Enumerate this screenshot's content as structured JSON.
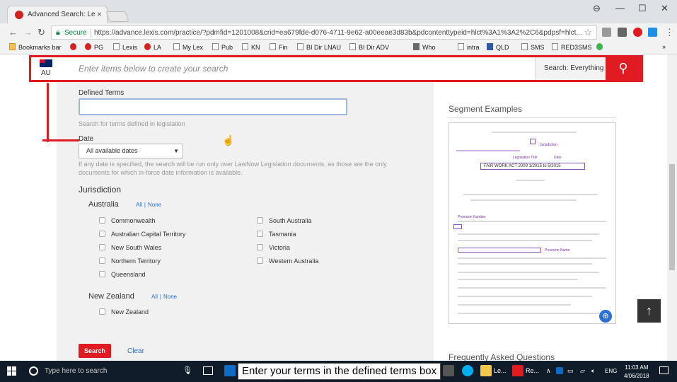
{
  "browser": {
    "tab_title": "Advanced Search: Legisla",
    "tab_close": "×",
    "window_controls": [
      "⊖",
      "—",
      "☐",
      "✕"
    ],
    "secure_label": "Secure",
    "url": "https://advance.lexis.com/practice/?pdmfid=1201008&crid=ea679fde-d076-4711-9e62-a00eeae3d83b&pdcontenttypeid=hlct%3A1%3A2%2C6&pdpsf=hlct...",
    "bookmarks": [
      "Bookmarks bar",
      "PG",
      "Lexis",
      "LA",
      "My Lex",
      "Pub",
      "KN",
      "Fin",
      "BI Dir LNAU",
      "BI Dir ADV",
      "Who",
      "intra",
      "QLD",
      "SMS",
      "RED3SMS"
    ],
    "overflow": "»"
  },
  "searchbar": {
    "jurisdiction": "AU",
    "placeholder": "Enter items below to create your search",
    "scope": "Search: Everything",
    "search_icon": "search-icon"
  },
  "form": {
    "defined_terms_label": "Defined Terms",
    "defined_terms_value": "",
    "defined_terms_help": "Search for terms defined in legislation",
    "date_label": "Date",
    "date_selected": "All available dates",
    "date_help_1": "If any date is specified, the search will be run only over LawNow Legislation documents, as those are the only",
    "date_help_2": "documents for which in-force date information is available.",
    "jurisdiction_title": "Jurisdiction",
    "australia": {
      "title": "Australia",
      "all": "All",
      "none": "None",
      "left": [
        "Commonwealth",
        "Australian Capital Territory",
        "New South Wales",
        "Northern Territory",
        "Queensland"
      ],
      "right": [
        "South Australia",
        "Tasmania",
        "Victoria",
        "Western Australia"
      ]
    },
    "new_zealand": {
      "title": "New Zealand",
      "all": "All",
      "none": "None",
      "items": [
        "New Zealand"
      ]
    },
    "search_button": "Search",
    "clear_link": "Clear"
  },
  "sidebar": {
    "segment_title": "Segment Examples",
    "faq_title": "Frequently Asked Questions",
    "example": {
      "jurisdiction": "Jurisdiction",
      "legislation_title": "Legislation Title",
      "date": "Date",
      "title_box": "FAIR WORK ACT 2009 1/2015 to 5/2015",
      "provision_number": "Provision Number",
      "provision_name": "Provision Name"
    }
  },
  "taskbar": {
    "search_placeholder": "Type here to search",
    "caption": "Enter your terms in the defined terms box",
    "app_labels": [
      "Le...",
      "Re..."
    ],
    "language": "ENG",
    "time": "11:03 AM",
    "date": "4/06/2018"
  }
}
